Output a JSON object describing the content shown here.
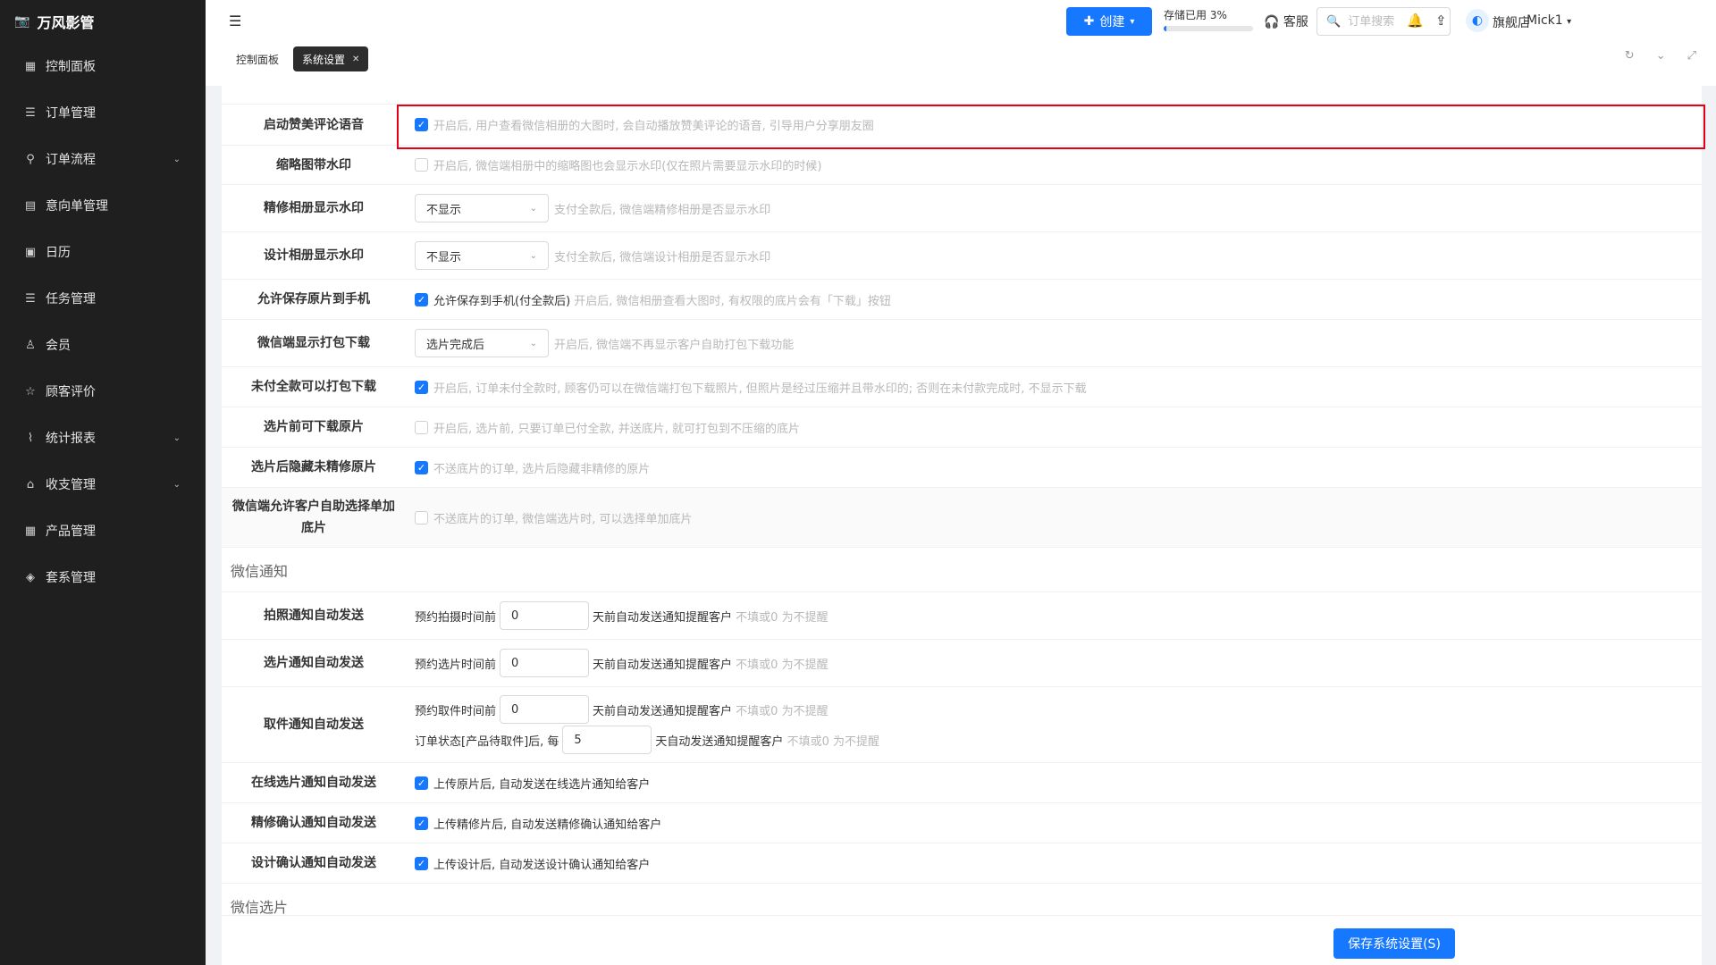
{
  "app": {
    "name": "万风影管"
  },
  "sidebar": {
    "items": [
      {
        "label": "控制面板",
        "icon": "grid-icon",
        "expand": false
      },
      {
        "label": "订单管理",
        "icon": "list-icon",
        "expand": false
      },
      {
        "label": "订单流程",
        "icon": "flow-icon",
        "expand": true
      },
      {
        "label": "意向单管理",
        "icon": "clipboard-icon",
        "expand": false
      },
      {
        "label": "日历",
        "icon": "calendar-icon",
        "expand": false
      },
      {
        "label": "任务管理",
        "icon": "list-icon",
        "expand": false
      },
      {
        "label": "会员",
        "icon": "user-icon",
        "expand": false
      },
      {
        "label": "顾客评价",
        "icon": "star-icon",
        "expand": false
      },
      {
        "label": "统计报表",
        "icon": "chart-icon",
        "expand": true
      },
      {
        "label": "收支管理",
        "icon": "bank-icon",
        "expand": true
      },
      {
        "label": "产品管理",
        "icon": "grid-icon",
        "expand": false
      },
      {
        "label": "套系管理",
        "icon": "box-icon",
        "expand": false
      }
    ]
  },
  "header": {
    "create_label": "创建",
    "storage_label": "存储已用 3%",
    "storage_percent": 3,
    "service_label": "客服",
    "search_placeholder": "订单搜索",
    "shop_name": "旗舰店",
    "user_name": "Mick1",
    "tabs": [
      {
        "label": "控制面板",
        "active": false
      },
      {
        "label": "系统设置",
        "active": true
      }
    ]
  },
  "settings": {
    "praise_voice": {
      "label": "启动赞美评论语音",
      "hint": "开启后, 用户查看微信相册的大图时, 会自动播放赞美评论的语音, 引导用户分享朋友圈"
    },
    "thumb_watermark": {
      "label": "缩略图带水印",
      "hint": "开启后, 微信端相册中的缩略图也会显示水印(仅在照片需要显示水印的时候)"
    },
    "retouch_watermark": {
      "label": "精修相册显示水印",
      "value": "不显示",
      "hint": "支付全款后, 微信端精修相册是否显示水印"
    },
    "design_watermark": {
      "label": "设计相册显示水印",
      "value": "不显示",
      "hint": "支付全款后, 微信端设计相册是否显示水印"
    },
    "save_original": {
      "label": "允许保存原片到手机",
      "text": "允许保存到手机(付全款后)",
      "hint": "开启后, 微信相册查看大图时, 有权限的底片会有「下载」按钮"
    },
    "pack_download": {
      "label": "微信端显示打包下载",
      "value": "选片完成后",
      "hint": "开启后, 微信端不再显示客户自助打包下载功能"
    },
    "unpaid_download": {
      "label": "未付全款可以打包下载",
      "hint": "开启后, 订单未付全款时, 顾客仍可以在微信端打包下载照片, 但照片是经过压缩并且带水印的; 否则在未付款完成时, 不显示下载"
    },
    "pre_select_download": {
      "label": "选片前可下载原片",
      "hint": "开启后, 选片前, 只要订单已付全款, 并送底片, 就可打包到不压缩的底片"
    },
    "hide_unretouched": {
      "label": "选片后隐藏未精修原片",
      "hint": "不送底片的订单, 选片后隐藏非精修的原片"
    },
    "add_negatives": {
      "label": "微信端允许客户自助选择单加底片",
      "hint": "不送底片的订单, 微信端选片时, 可以选择单加底片"
    }
  },
  "wechat_notify": {
    "title": "微信通知",
    "shoot": {
      "label": "拍照通知自动发送",
      "prefix": "预约拍摄时间前",
      "value": "0",
      "suffix": "天前自动发送通知提醒客户",
      "hint": "不填或0 为不提醒"
    },
    "select": {
      "label": "选片通知自动发送",
      "prefix": "预约选片时间前",
      "value": "0",
      "suffix": "天前自动发送通知提醒客户",
      "hint": "不填或0 为不提醒"
    },
    "pickup": {
      "label": "取件通知自动发送",
      "prefix": "预约取件时间前",
      "value": "0",
      "suffix": "天前自动发送通知提醒客户",
      "hint": "不填或0 为不提醒",
      "prefix2": "订单状态[产品待取件]后, 每",
      "value2": "5",
      "suffix2": "天自动发送通知提醒客户",
      "hint2": "不填或0 为不提醒"
    },
    "online_select": {
      "label": "在线选片通知自动发送",
      "text": "上传原片后, 自动发送在线选片通知给客户"
    },
    "retouch_confirm": {
      "label": "精修确认通知自动发送",
      "text": "上传精修片后, 自动发送精修确认通知给客户"
    },
    "design_confirm": {
      "label": "设计确认通知自动发送",
      "text": "上传设计后, 自动发送设计确认通知给客户"
    }
  },
  "wechat_select": {
    "title": "微信选片"
  },
  "footer": {
    "save_label": "保存系统设置(S)"
  },
  "colors": {
    "accent": "#1677ff",
    "sidebar_bg": "#1f1f1f",
    "highlight": "#e60012"
  }
}
